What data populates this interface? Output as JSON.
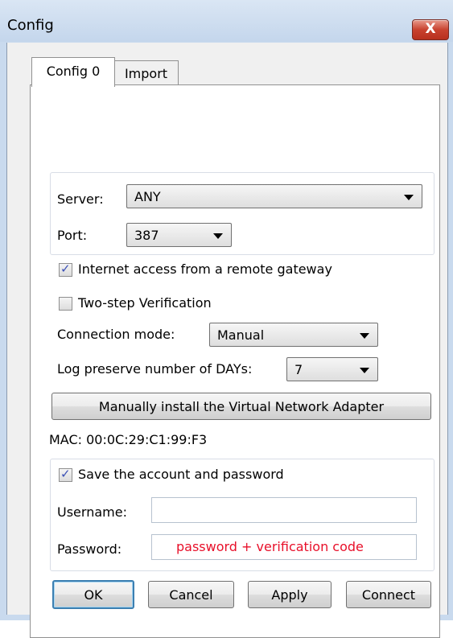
{
  "window": {
    "title": "Config",
    "close_glyph": "X"
  },
  "tabs": [
    {
      "label": "Config 0",
      "active": true
    },
    {
      "label": "Import",
      "active": false
    }
  ],
  "server": {
    "label": "Server:",
    "value": "ANY"
  },
  "port": {
    "label": "Port:",
    "value": "387"
  },
  "options": {
    "internet_access": {
      "label": "Internet access from a remote gateway",
      "checked": true
    },
    "two_step": {
      "label": "Two-step Verification",
      "checked": false
    }
  },
  "connection_mode": {
    "label": "Connection mode:",
    "value": "Manual"
  },
  "log_days": {
    "label": "Log preserve number of DAYs:",
    "value": "7"
  },
  "install_adapter_label": "Manually install the Virtual Network Adapter",
  "mac": "MAC: 00:0C:29:C1:99:F3",
  "account": {
    "save_label": "Save the account and password",
    "save_checked": true,
    "username_label": "Username:",
    "username_value": "",
    "password_label": "Password:",
    "password_hint": "password + verification code",
    "hint_color": "#e8102a"
  },
  "buttons": {
    "ok": "OK",
    "cancel": "Cancel",
    "apply": "Apply",
    "connect": "Connect"
  }
}
